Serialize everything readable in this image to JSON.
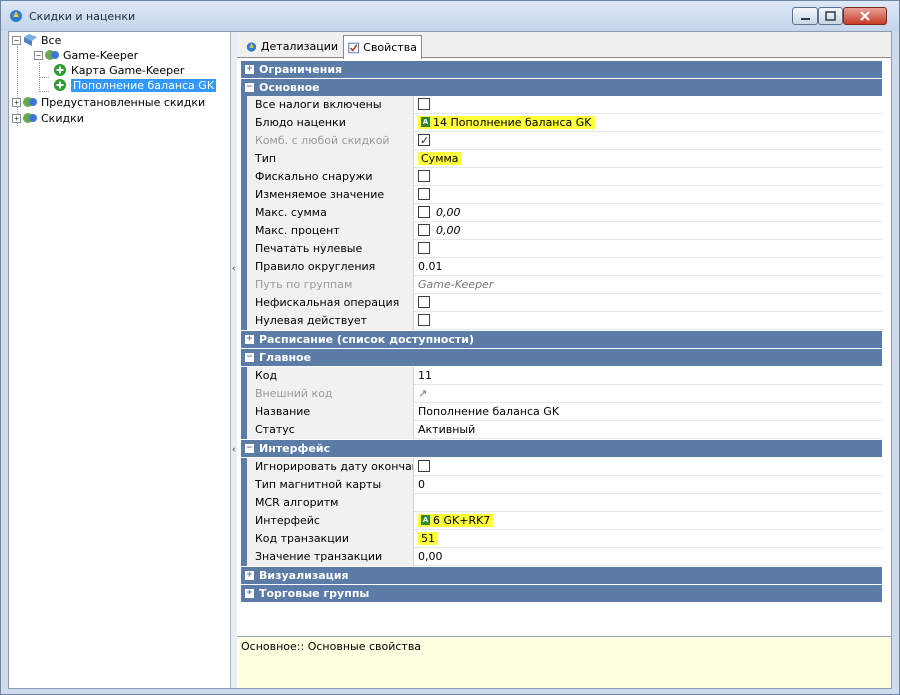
{
  "window": {
    "title": "Скидки и наценки"
  },
  "tree": {
    "root": "Все",
    "group": "Game-Keeper",
    "items": [
      "Карта Game-Keeper",
      "Пополнение баланса GK"
    ],
    "others": [
      "Предустановленные скидки",
      "Скидки"
    ]
  },
  "tabs": [
    "Детализации",
    "Свойства"
  ],
  "sections": {
    "limits": "Ограничения",
    "basic": "Основное",
    "schedule": "Расписание (список доступности)",
    "main": "Главное",
    "interface": "Интерфейс",
    "visual": "Визуализация",
    "trade": "Торговые группы"
  },
  "basic": {
    "all_taxes": "Все налоги включены",
    "dish_label": "Блюдо наценки",
    "dish_value": "14 Пополнение баланса GK",
    "combo": "Комб. с любой скидкой",
    "type_label": "Тип",
    "type_value": "Сумма",
    "fiscal_out": "Фискально снаружи",
    "changeable": "Изменяемое значение",
    "max_sum_label": "Макс. сумма",
    "max_sum_value": "0,00",
    "max_pct_label": "Макс. процент",
    "max_pct_value": "0,00",
    "print_zero": "Печатать нулевые",
    "rounding_label": "Правило округления",
    "rounding_value": "0.01",
    "path_label": "Путь по группам",
    "path_value": "Game-Keeper",
    "nonfiscal": "Нефискальная операция",
    "zero_active": "Нулевая действует"
  },
  "main": {
    "code_label": "Код",
    "code_value": "11",
    "ext_code_label": "Внешний код",
    "ext_code_value": "↗",
    "name_label": "Название",
    "name_value": "Пополнение баланса GK",
    "status_label": "Статус",
    "status_value": "Активный"
  },
  "interface": {
    "ignore_end": "Игнорировать дату окончания",
    "mag_type_label": "Тип магнитной карты",
    "mag_type_value": "0",
    "mcr_label": "MCR алгоритм",
    "iface_label": "Интерфейс",
    "iface_value": "6 GK+RK7",
    "trans_code_label": "Код транзакции",
    "trans_code_value": "51",
    "trans_value_label": "Значение транзакции",
    "trans_value_value": "0,00"
  },
  "description": "Основное:: Основные свойства",
  "colors": {
    "category": "#5b7ca6",
    "highlight": "#ffff3b",
    "selected": "#3399ff",
    "desc_bg": "#ffffe1"
  }
}
